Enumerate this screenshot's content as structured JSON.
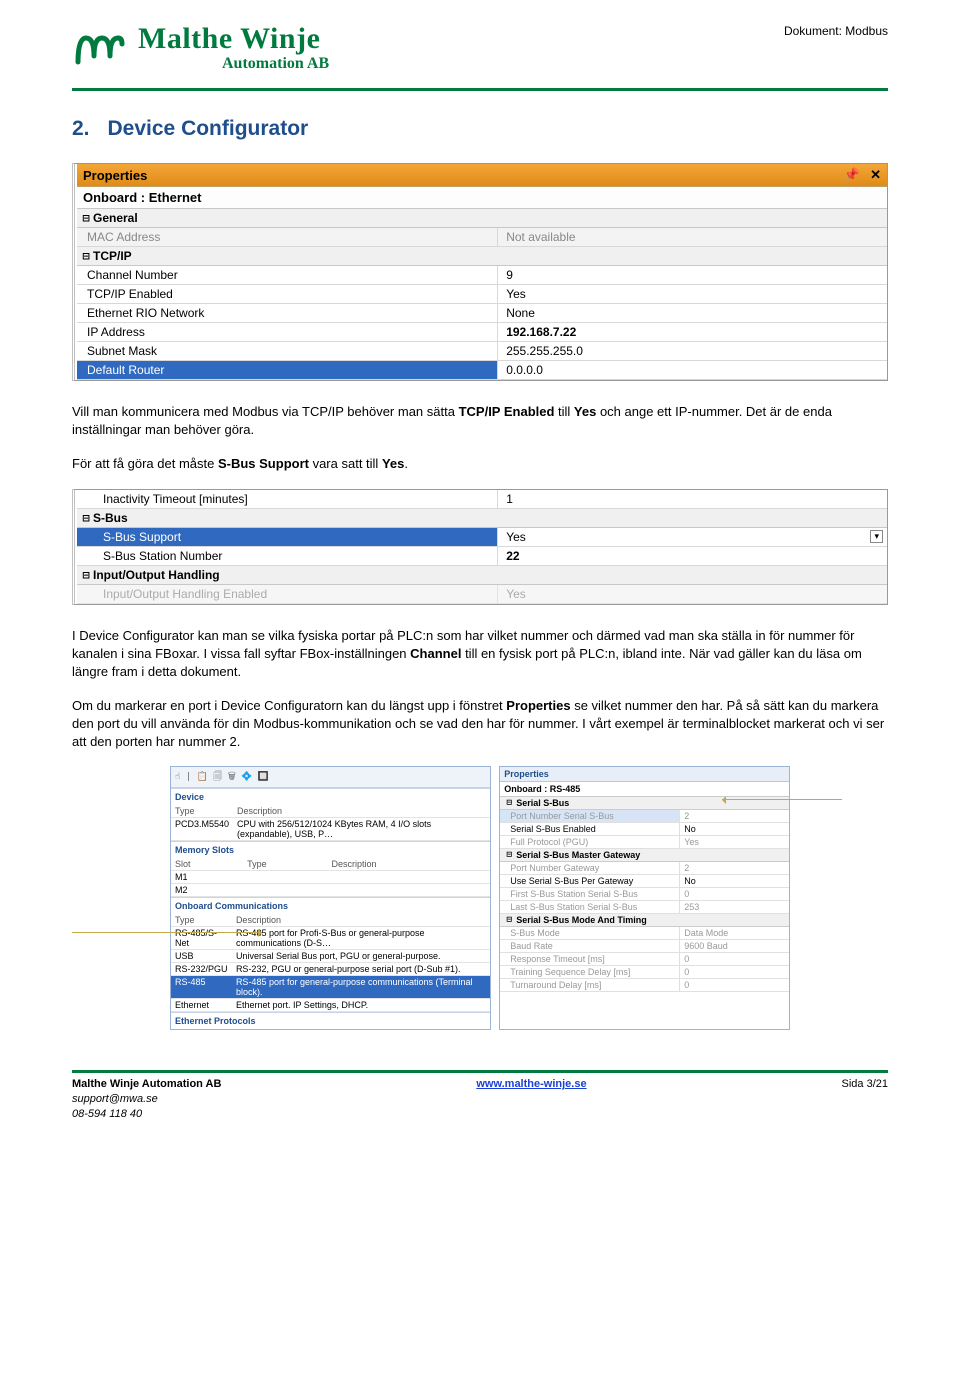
{
  "header": {
    "doc_label": "Dokument: Modbus",
    "logo_line1": "Malthe Winje",
    "logo_line2": "Automation AB"
  },
  "section": {
    "number": "2.",
    "title": "Device Configurator"
  },
  "shot1": {
    "panel_title": "Properties",
    "subtitle": "Onboard : Ethernet",
    "cat_general": "General",
    "mac_label": "MAC Address",
    "mac_val": "Not available",
    "cat_tcpip": "TCP/IP",
    "ch_label": "Channel Number",
    "ch_val": "9",
    "en_label": "TCP/IP Enabled",
    "en_val": "Yes",
    "rio_label": "Ethernet RIO Network",
    "rio_val": "None",
    "ip_label": "IP Address",
    "ip_val": "192.168.7.22",
    "subnet_label": "Subnet Mask",
    "subnet_val": "255.255.255.0",
    "dr_label": "Default Router",
    "dr_val": "0.0.0.0"
  },
  "para1": "Vill man kommunicera med Modbus via TCP/IP behöver man sätta ",
  "para1_b1": "TCP/IP Enabled",
  "para1_mid": " till ",
  "para1_b2": "Yes",
  "para1_end": " och ange ett IP-nummer. Det är de enda inställningar man behöver göra.",
  "para2_a": "För att få göra det måste ",
  "para2_b": "S-Bus Support",
  "para2_c": " vara satt till ",
  "para2_d": "Yes",
  "para2_e": ".",
  "shot2": {
    "inact_label": "Inactivity Timeout [minutes]",
    "inact_val": "1",
    "cat_sbus": "S-Bus",
    "supp_label": "S-Bus Support",
    "supp_val": "Yes",
    "stn_label": "S-Bus Station Number",
    "stn_val": "22",
    "cat_io": "Input/Output Handling",
    "ioen_label": "Input/Output Handling Enabled",
    "ioen_val": "Yes"
  },
  "para3": "I Device Configurator kan man se vilka fysiska portar på PLC:n som har vilket nummer och därmed vad man ska ställa in för nummer för kanalen i sina FBoxar. I vissa fall syftar FBox-inställningen ",
  "para3_b": "Channel",
  "para3_end": " till en fysisk port på PLC:n, ibland inte. När vad gäller kan du läsa om längre fram i detta dokument.",
  "para4_a": "Om du markerar en port i Device Configuratorn kan du längst upp i fönstret ",
  "para4_b": "Properties",
  "para4_c": " se vilket nummer den har. På så sätt kan du markera den port du vill använda för din Modbus-kommunikation och se vad den har för nummer. I vårt exempel är terminalblocket markerat och vi ser att den porten har nummer 2.",
  "shot3": {
    "toolbar": "☝ | 📋 🗐 🗑 💠 🔲",
    "left": {
      "device_head": "Device",
      "type_lbl": "Type",
      "desc_lbl": "Description",
      "dev_type": "PCD3.M5540",
      "dev_desc": "CPU with 256/512/1024 KBytes RAM, 4 I/O slots (expandable), USB, P…",
      "mem_head": "Memory Slots",
      "slot_lbl": "Slot",
      "m1": "M1",
      "m2": "M2",
      "comm_head": "Onboard Communications",
      "rows": [
        {
          "t": "RS-485/S-Net",
          "d": "RS-485 port for Profi-S-Bus or general-purpose communications (D-S…"
        },
        {
          "t": "USB",
          "d": "Universal Serial Bus port, PGU or general-purpose."
        },
        {
          "t": "RS-232/PGU",
          "d": "RS-232, PGU or general-purpose serial port (D-Sub #1)."
        },
        {
          "t": "RS-485",
          "d": "RS-485 port for general-purpose communications (Terminal block)."
        },
        {
          "t": "Ethernet",
          "d": "Ethernet port. IP Settings, DHCP."
        }
      ],
      "eth_head": "Ethernet Protocols"
    },
    "right": {
      "panel_title": "Properties",
      "subtitle": "Onboard : RS-485",
      "cat1": "Serial S-Bus",
      "r1l": "Port Number Serial S-Bus",
      "r1v": "2",
      "r2l": "Serial S-Bus Enabled",
      "r2v": "No",
      "r3l": "Full Protocol (PGU)",
      "r3v": "Yes",
      "cat2": "Serial S-Bus Master Gateway",
      "r4l": "Port Number Gateway",
      "r4v": "2",
      "r5l": "Use Serial S-Bus Per Gateway",
      "r5v": "No",
      "r6l": "First S-Bus Station Serial S-Bus",
      "r6v": "0",
      "r7l": "Last S-Bus Station Serial S-Bus",
      "r7v": "253",
      "cat3": "Serial S-Bus Mode And Timing",
      "r8l": "S-Bus Mode",
      "r8v": "Data Mode",
      "r9l": "Baud Rate",
      "r9v": "9600 Baud",
      "r10l": "Response Timeout [ms]",
      "r10v": "0",
      "r11l": "Training Sequence Delay [ms]",
      "r11v": "0",
      "r12l": "Turnaround Delay [ms]",
      "r12v": "0"
    }
  },
  "footer": {
    "company": "Malthe Winje Automation AB",
    "email": "support@mwa.se",
    "phone": "08-594 118 40",
    "url": "www.malthe-winje.se",
    "page": "Sida 3/21"
  }
}
